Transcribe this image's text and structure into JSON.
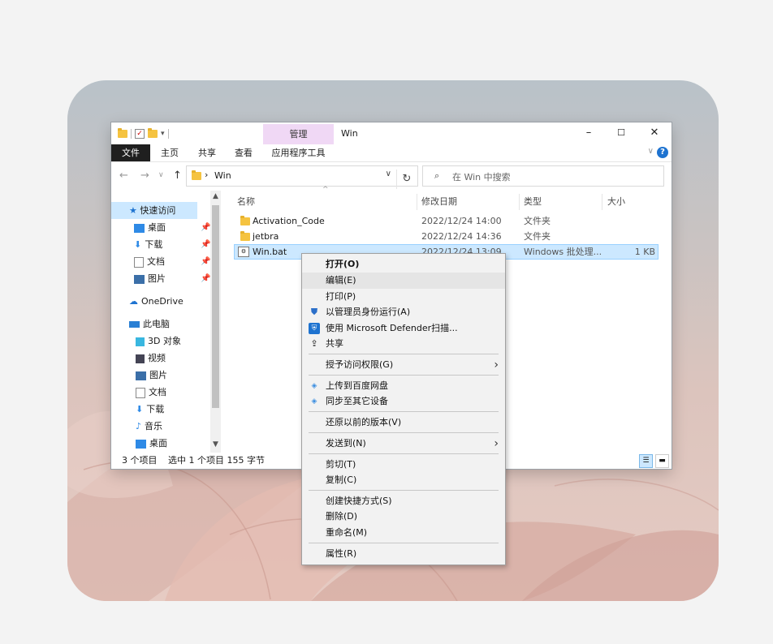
{
  "window": {
    "title": "Win",
    "contextual_tab_header": "管理",
    "controls": {
      "minimize": "–",
      "maximize": "☐",
      "close": "✕"
    }
  },
  "ribbon": {
    "tabs": [
      "文件",
      "主页",
      "共享",
      "查看",
      "应用程序工具"
    ]
  },
  "address": {
    "path": "Win",
    "search_placeholder": "在 Win 中搜索"
  },
  "nav": {
    "quick_access": "快速访问",
    "quick_items": [
      "桌面",
      "下载",
      "文档",
      "图片"
    ],
    "onedrive": "OneDrive",
    "this_pc": "此电脑",
    "pc_items": [
      "3D 对象",
      "视频",
      "图片",
      "文档",
      "下载",
      "音乐",
      "桌面"
    ]
  },
  "columns": {
    "name": "名称",
    "date": "修改日期",
    "type": "类型",
    "size": "大小"
  },
  "files": [
    {
      "name": "Activation_Code",
      "date": "2022/12/24 14:00",
      "type": "文件夹",
      "size": ""
    },
    {
      "name": "jetbra",
      "date": "2022/12/24 14:36",
      "type": "文件夹",
      "size": ""
    },
    {
      "name": "Win.bat",
      "date": "2022/12/24 13:09",
      "type": "Windows 批处理...",
      "size": "1 KB"
    }
  ],
  "status": {
    "count": "3 个项目",
    "selected": "选中 1 个项目 155 字节"
  },
  "context_menu": {
    "open": "打开(O)",
    "edit": "编辑(E)",
    "print": "打印(P)",
    "run_as_admin": "以管理员身份运行(A)",
    "defender": "使用 Microsoft Defender扫描...",
    "share": "共享",
    "grant_access": "授予访问权限(G)",
    "upload_baidu": "上传到百度网盘",
    "sync_devices": "同步至其它设备",
    "restore_versions": "还原以前的版本(V)",
    "send_to": "发送到(N)",
    "cut": "剪切(T)",
    "copy": "复制(C)",
    "create_shortcut": "创建快捷方式(S)",
    "delete": "删除(D)",
    "rename": "重命名(M)",
    "properties": "属性(R)"
  },
  "colors": {
    "accent": "#1e73d0",
    "selection": "#cce8ff",
    "context_tab": "#f0d8f5"
  }
}
